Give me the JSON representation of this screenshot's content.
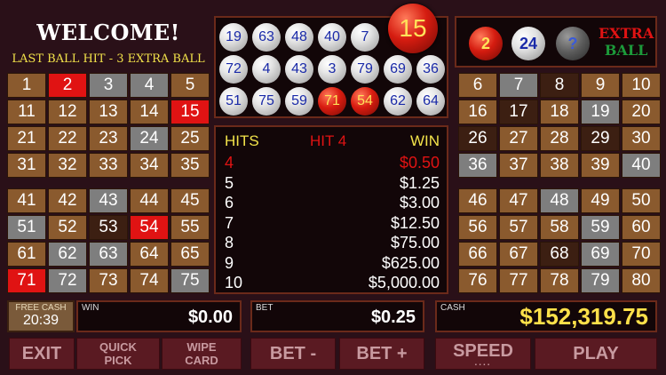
{
  "header": {
    "welcome": "WELCOME!",
    "status": "LAST BALL HIT - 3 EXTRA BALL"
  },
  "board": {
    "q1": [
      {
        "n": "1",
        "s": "b"
      },
      {
        "n": "2",
        "s": "r"
      },
      {
        "n": "3",
        "s": "g"
      },
      {
        "n": "4",
        "s": "g"
      },
      {
        "n": "5",
        "s": "b"
      },
      {
        "n": "11",
        "s": "b"
      },
      {
        "n": "12",
        "s": "b"
      },
      {
        "n": "13",
        "s": "b"
      },
      {
        "n": "14",
        "s": "b"
      },
      {
        "n": "15",
        "s": "r"
      },
      {
        "n": "21",
        "s": "b"
      },
      {
        "n": "22",
        "s": "b"
      },
      {
        "n": "23",
        "s": "b"
      },
      {
        "n": "24",
        "s": "g"
      },
      {
        "n": "25",
        "s": "b"
      },
      {
        "n": "31",
        "s": "b"
      },
      {
        "n": "32",
        "s": "b"
      },
      {
        "n": "33",
        "s": "b"
      },
      {
        "n": "34",
        "s": "b"
      },
      {
        "n": "35",
        "s": "b"
      }
    ],
    "q2": [
      {
        "n": "6",
        "s": "b"
      },
      {
        "n": "7",
        "s": "g"
      },
      {
        "n": "8",
        "s": "d"
      },
      {
        "n": "9",
        "s": "b"
      },
      {
        "n": "10",
        "s": "b"
      },
      {
        "n": "16",
        "s": "b"
      },
      {
        "n": "17",
        "s": "d"
      },
      {
        "n": "18",
        "s": "b"
      },
      {
        "n": "19",
        "s": "g"
      },
      {
        "n": "20",
        "s": "b"
      },
      {
        "n": "26",
        "s": "d"
      },
      {
        "n": "27",
        "s": "b"
      },
      {
        "n": "28",
        "s": "b"
      },
      {
        "n": "29",
        "s": "d"
      },
      {
        "n": "30",
        "s": "b"
      },
      {
        "n": "36",
        "s": "g"
      },
      {
        "n": "37",
        "s": "b"
      },
      {
        "n": "38",
        "s": "b"
      },
      {
        "n": "39",
        "s": "b"
      },
      {
        "n": "40",
        "s": "g"
      }
    ],
    "q3": [
      {
        "n": "41",
        "s": "b"
      },
      {
        "n": "42",
        "s": "b"
      },
      {
        "n": "43",
        "s": "g"
      },
      {
        "n": "44",
        "s": "b"
      },
      {
        "n": "45",
        "s": "b"
      },
      {
        "n": "51",
        "s": "g"
      },
      {
        "n": "52",
        "s": "b"
      },
      {
        "n": "53",
        "s": "d"
      },
      {
        "n": "54",
        "s": "r"
      },
      {
        "n": "55",
        "s": "b"
      },
      {
        "n": "61",
        "s": "b"
      },
      {
        "n": "62",
        "s": "g"
      },
      {
        "n": "63",
        "s": "g"
      },
      {
        "n": "64",
        "s": "b"
      },
      {
        "n": "65",
        "s": "b"
      },
      {
        "n": "71",
        "s": "r"
      },
      {
        "n": "72",
        "s": "g"
      },
      {
        "n": "73",
        "s": "b"
      },
      {
        "n": "74",
        "s": "b"
      },
      {
        "n": "75",
        "s": "g"
      }
    ],
    "q4": [
      {
        "n": "46",
        "s": "b"
      },
      {
        "n": "47",
        "s": "b"
      },
      {
        "n": "48",
        "s": "g"
      },
      {
        "n": "49",
        "s": "b"
      },
      {
        "n": "50",
        "s": "b"
      },
      {
        "n": "56",
        "s": "b"
      },
      {
        "n": "57",
        "s": "b"
      },
      {
        "n": "58",
        "s": "b"
      },
      {
        "n": "59",
        "s": "g"
      },
      {
        "n": "60",
        "s": "b"
      },
      {
        "n": "66",
        "s": "b"
      },
      {
        "n": "67",
        "s": "b"
      },
      {
        "n": "68",
        "s": "d"
      },
      {
        "n": "69",
        "s": "g"
      },
      {
        "n": "70",
        "s": "b"
      },
      {
        "n": "76",
        "s": "b"
      },
      {
        "n": "77",
        "s": "b"
      },
      {
        "n": "78",
        "s": "b"
      },
      {
        "n": "79",
        "s": "g"
      },
      {
        "n": "80",
        "s": "b"
      }
    ]
  },
  "drawn": {
    "last": "15",
    "balls": [
      {
        "n": "19",
        "red": false
      },
      {
        "n": "63",
        "red": false
      },
      {
        "n": "48",
        "red": false
      },
      {
        "n": "40",
        "red": false
      },
      {
        "n": "7",
        "red": false
      },
      {
        "n": "",
        "red": false
      },
      {
        "n": "",
        "red": false
      },
      {
        "n": "72",
        "red": false
      },
      {
        "n": "4",
        "red": false
      },
      {
        "n": "43",
        "red": false
      },
      {
        "n": "3",
        "red": false
      },
      {
        "n": "79",
        "red": false
      },
      {
        "n": "69",
        "red": false
      },
      {
        "n": "36",
        "red": false
      },
      {
        "n": "51",
        "red": false
      },
      {
        "n": "75",
        "red": false
      },
      {
        "n": "59",
        "red": false
      },
      {
        "n": "71",
        "red": true
      },
      {
        "n": "54",
        "red": true
      },
      {
        "n": "62",
        "red": false
      },
      {
        "n": "64",
        "red": false
      }
    ]
  },
  "extra": {
    "ball1": "2",
    "ball2": "24",
    "ball3": "?",
    "label1": "EXTRA",
    "label2": "BALL"
  },
  "paytable": {
    "col_hits": "HITS",
    "col_hit": "HIT 4",
    "col_win": "WIN",
    "rows": [
      {
        "hits": "4",
        "win": "$0.50",
        "active": true
      },
      {
        "hits": "5",
        "win": "$1.25",
        "active": false
      },
      {
        "hits": "6",
        "win": "$3.00",
        "active": false
      },
      {
        "hits": "7",
        "win": "$12.50",
        "active": false
      },
      {
        "hits": "8",
        "win": "$75.00",
        "active": false
      },
      {
        "hits": "9",
        "win": "$625.00",
        "active": false
      },
      {
        "hits": "10",
        "win": "$5,000.00",
        "active": false
      }
    ]
  },
  "freecash": {
    "label": "FREE CASH",
    "timer": "20:39"
  },
  "win": {
    "label": "WIN",
    "value": "$0.00"
  },
  "bet": {
    "label": "BET",
    "value": "$0.25"
  },
  "cash": {
    "label": "CASH",
    "value": "$152,319.75"
  },
  "buttons": {
    "exit": "EXIT",
    "quick1": "QUICK",
    "quick2": "PICK",
    "wipe1": "WIPE",
    "wipe2": "CARD",
    "bet_minus": "BET -",
    "bet_plus": "BET +",
    "speed": "SPEED",
    "speed_dots": "....",
    "play": "PLAY"
  },
  "colors": {
    "ball_red": "#d51c10",
    "marked": "#e01313",
    "text_yellow": "#f2e24a",
    "cash_yellow": "#ffe14a"
  }
}
